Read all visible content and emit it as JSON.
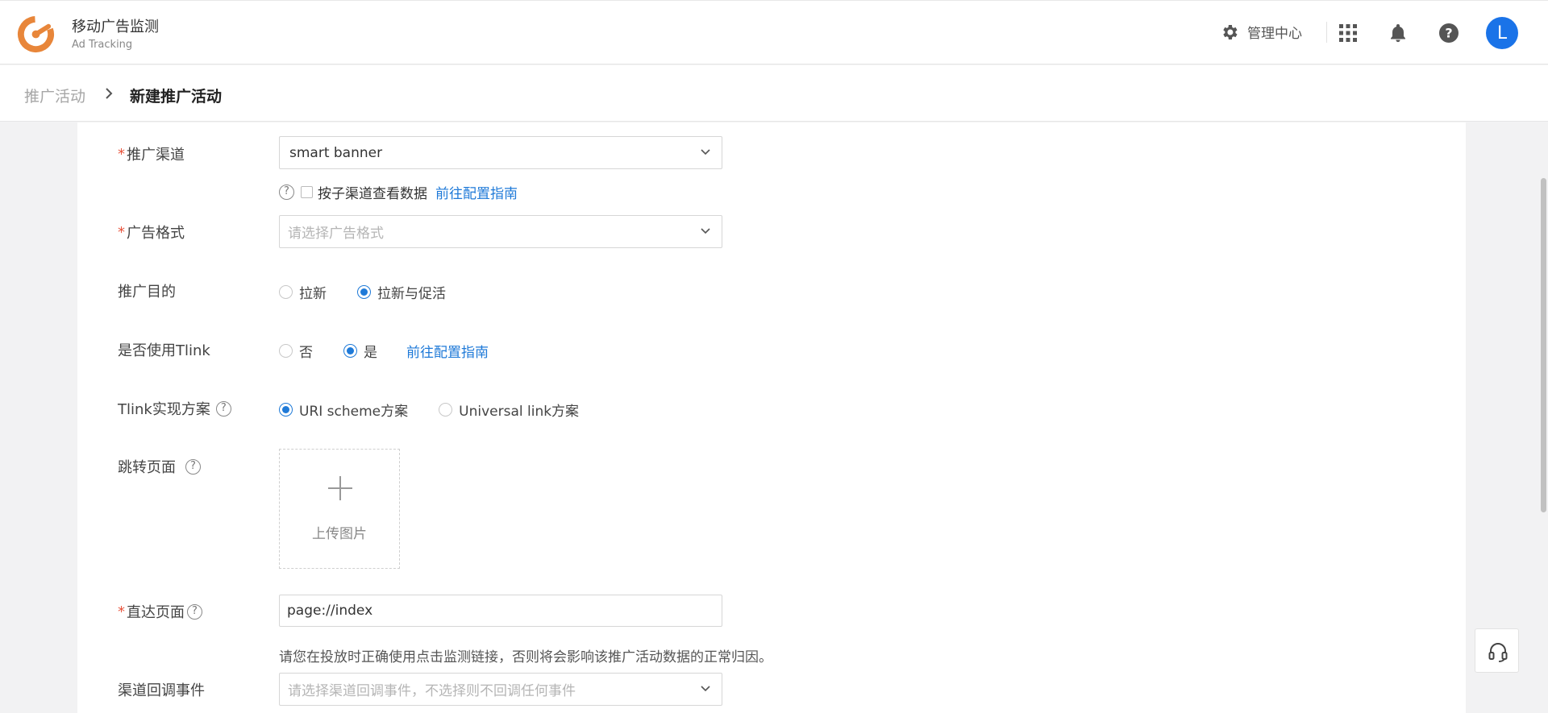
{
  "app": {
    "title": "移动广告监测",
    "subtitle": "Ad Tracking"
  },
  "header": {
    "admin_label": "管理中心",
    "avatar_initial": "L"
  },
  "breadcrumb": {
    "parent": "推广活动",
    "current": "新建推广活动"
  },
  "form": {
    "channel": {
      "label": "推广渠道",
      "value": "smart banner"
    },
    "subchannel": {
      "checkbox_label": "按子渠道查看数据",
      "guide_link": "前往配置指南",
      "checked": false
    },
    "ad_format": {
      "label": "广告格式",
      "placeholder": "请选择广告格式"
    },
    "purpose": {
      "label": "推广目的",
      "options": [
        "拉新",
        "拉新与促活"
      ],
      "selected": "拉新与促活"
    },
    "tlink": {
      "label": "是否使用Tlink",
      "options": [
        "否",
        "是"
      ],
      "selected": "是",
      "guide_link": "前往配置指南"
    },
    "tlink_scheme": {
      "label": "Tlink实现方案",
      "options": [
        "URI scheme方案",
        "Universal link方案"
      ],
      "selected": "URI scheme方案"
    },
    "landing_page": {
      "label": "跳转页面",
      "upload_text": "上传图片"
    },
    "direct_page": {
      "label": "直达页面",
      "value": "page://index",
      "hint": "请您在投放时正确使用点击监测链接，否则将会影响该推广活动数据的正常归因。"
    },
    "callback_event": {
      "label": "渠道回调事件",
      "placeholder": "请选择渠道回调事件，不选择则不回调任何事件"
    }
  },
  "colors": {
    "accent": "#1f7ad8",
    "required": "#e8553e",
    "brand": "#e8863a"
  }
}
